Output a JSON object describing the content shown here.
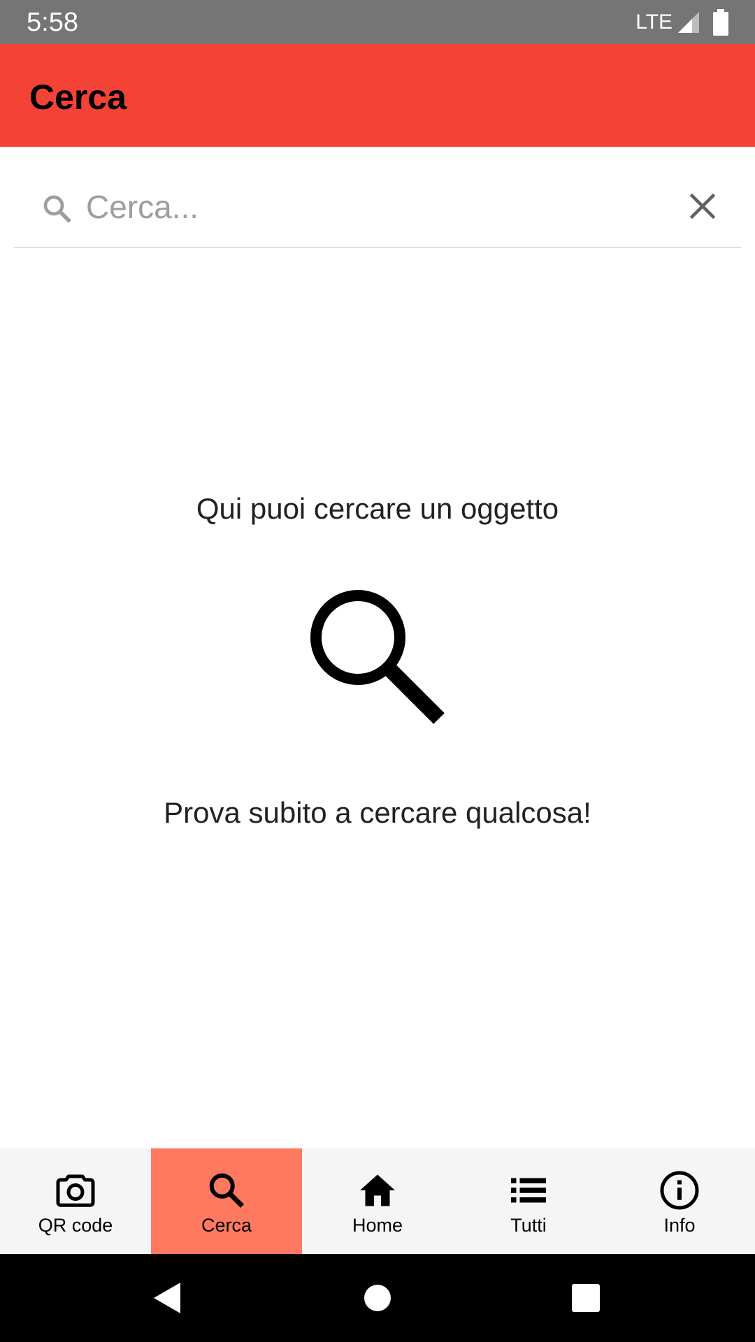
{
  "status_bar": {
    "time": "5:58",
    "network": "LTE",
    "icons": [
      "signal-icon",
      "battery-icon"
    ]
  },
  "app_bar": {
    "title": "Cerca",
    "color": "#f44336"
  },
  "search": {
    "placeholder": "Cerca...",
    "value": "",
    "icon": "search-icon",
    "clear_icon": "close-icon"
  },
  "empty_state": {
    "title": "Qui puoi cercare un oggetto",
    "icon": "search-icon",
    "subtitle": "Prova subito a cercare qualcosa!"
  },
  "bottom_nav": {
    "active_color": "#ff7961",
    "items": [
      {
        "label": "QR code",
        "icon": "camera-icon",
        "active": false
      },
      {
        "label": "Cerca",
        "icon": "search-icon",
        "active": true
      },
      {
        "label": "Home",
        "icon": "home-icon",
        "active": false
      },
      {
        "label": "Tutti",
        "icon": "list-icon",
        "active": false
      },
      {
        "label": "Info",
        "icon": "info-icon",
        "active": false
      }
    ]
  },
  "system_nav": {
    "buttons": [
      "back-icon",
      "home-circle-icon",
      "recents-icon"
    ]
  }
}
